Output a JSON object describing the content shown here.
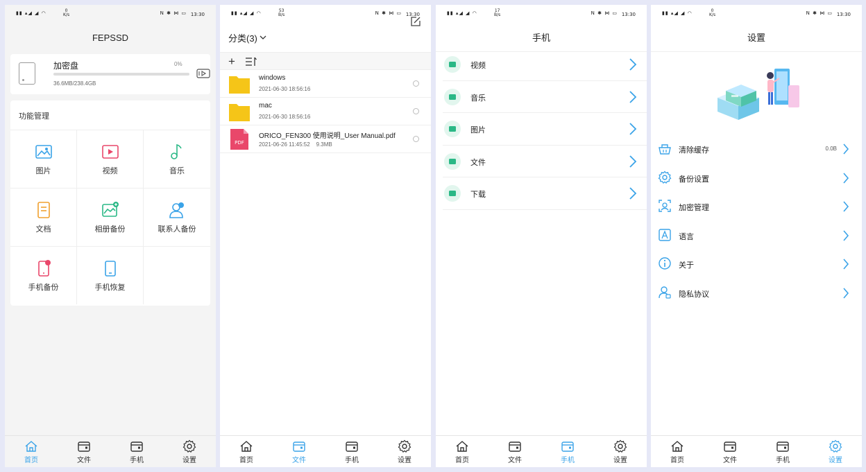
{
  "status_bar": {
    "signal_left": "▮▮ ▴◢ ◢ ◠",
    "signal_right": "N ✱ ⋈ ▭",
    "time": "13:30",
    "speeds": [
      "0\nK/s",
      "53\nB/s",
      "17\nB/s",
      "0\nK/s"
    ]
  },
  "tabs": [
    {
      "label": "首页",
      "icon": "home-icon"
    },
    {
      "label": "文件",
      "icon": "folder-icon"
    },
    {
      "label": "手机",
      "icon": "phone-icon"
    },
    {
      "label": "设置",
      "icon": "gear-icon"
    }
  ],
  "home": {
    "title": "FEPSSD",
    "disk": {
      "name": "加密盘",
      "percent_label": "0%",
      "used_fraction": 0.0,
      "size": "36.6MB/238.4GB"
    },
    "section_title": "功能管理",
    "functions": [
      {
        "label": "图片",
        "icon": "image-icon",
        "color": "#3aa3e8"
      },
      {
        "label": "视频",
        "icon": "video-icon",
        "color": "#e9476a"
      },
      {
        "label": "音乐",
        "icon": "music-icon",
        "color": "#2ab886"
      },
      {
        "label": "文档",
        "icon": "document-icon",
        "color": "#f0a02e"
      },
      {
        "label": "相册备份",
        "icon": "album-backup-icon",
        "color": "#2ab886"
      },
      {
        "label": "联系人备份",
        "icon": "contact-backup-icon",
        "color": "#3aa3e8"
      },
      {
        "label": "手机备份",
        "icon": "phone-backup-icon",
        "color": "#e9476a"
      },
      {
        "label": "手机恢复",
        "icon": "phone-restore-icon",
        "color": "#3aa3e8"
      }
    ]
  },
  "files": {
    "title": "分类(3)",
    "add_label": "+",
    "items": [
      {
        "name": "windows",
        "meta": "2021-06-30 18:56:16",
        "type": "folder"
      },
      {
        "name": "mac",
        "meta": "2021-06-30 18:56:16",
        "type": "folder"
      },
      {
        "name": "ORICO_FEN300 使用说明_User Manual.pdf",
        "meta": "2021-06-26 11:45:52    9.3MB",
        "type": "pdf",
        "badge": "PDF"
      }
    ]
  },
  "phone": {
    "title": "手机",
    "items": [
      {
        "label": "视频",
        "icon": "video-icon"
      },
      {
        "label": "音乐",
        "icon": "music-icon"
      },
      {
        "label": "图片",
        "icon": "image-icon"
      },
      {
        "label": "文件",
        "icon": "file-icon"
      },
      {
        "label": "下载",
        "icon": "download-icon"
      }
    ]
  },
  "settings": {
    "title": "设置",
    "items": [
      {
        "label": "清除缓存",
        "value": "0.0B",
        "icon": "clear-cache-icon"
      },
      {
        "label": "备份设置",
        "value": "",
        "icon": "gear-icon"
      },
      {
        "label": "加密管理",
        "value": "",
        "icon": "encrypt-icon"
      },
      {
        "label": "语言",
        "value": "",
        "icon": "language-icon"
      },
      {
        "label": "关于",
        "value": "",
        "icon": "info-icon"
      },
      {
        "label": "隐私协议",
        "value": "",
        "icon": "privacy-icon"
      }
    ]
  },
  "colors": {
    "accent": "#3aa3e8",
    "green": "#2ab886",
    "folder": "#f5c518",
    "pdf": "#e9476a"
  }
}
